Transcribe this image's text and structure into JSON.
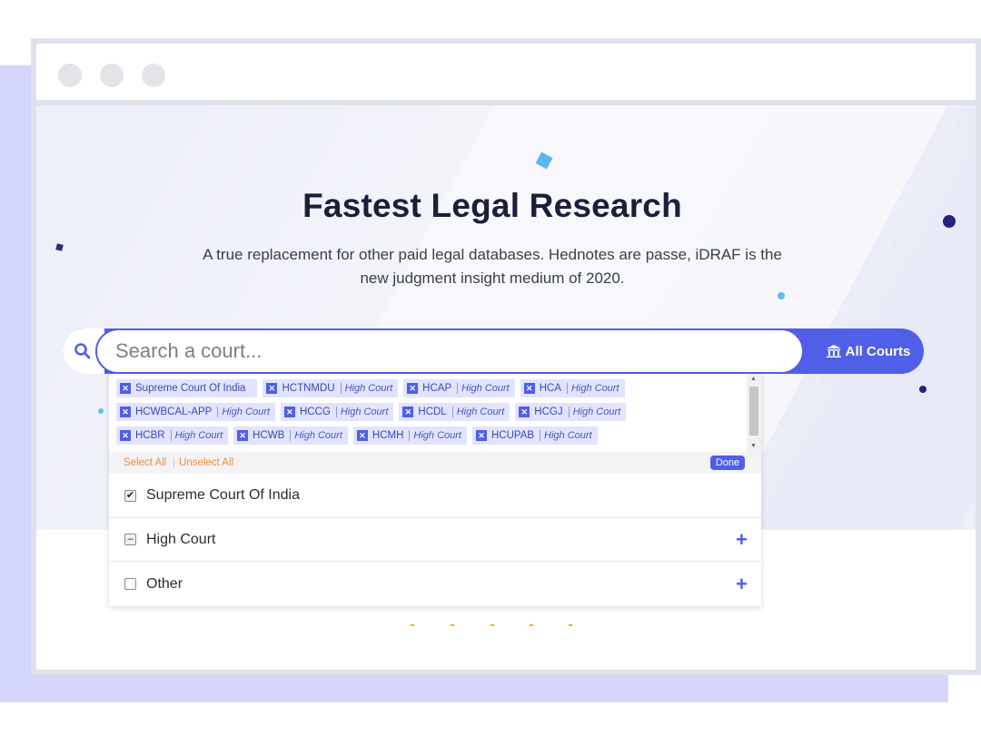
{
  "hero": {
    "title": "Fastest Legal Research",
    "subtitle_line1": "A true replacement for other paid legal databases. Hednotes are passe, iDRAF is the",
    "subtitle_line2": "new judgment insight medium of 2020."
  },
  "search": {
    "placeholder": "Search a court...",
    "courts_button_label": "All Courts",
    "courts_button_icon": "court-building-icon"
  },
  "chips": [
    [
      {
        "code": "Supreme Court Of India",
        "type": ""
      },
      {
        "code": "HCTNMDU",
        "type": "High Court"
      },
      {
        "code": "HCAP",
        "type": "High Court"
      },
      {
        "code": "HCA",
        "type": "High Court"
      }
    ],
    [
      {
        "code": "HCWBCAL-APP",
        "type": "High Court"
      },
      {
        "code": "HCCG",
        "type": "High Court"
      },
      {
        "code": "HCDL",
        "type": "High Court"
      },
      {
        "code": "HCGJ",
        "type": "High Court"
      }
    ],
    [
      {
        "code": "HCBR",
        "type": "High Court"
      },
      {
        "code": "HCWB",
        "type": "High Court"
      },
      {
        "code": "HCMH",
        "type": "High Court"
      },
      {
        "code": "HCUPAB",
        "type": "High Court"
      }
    ]
  ],
  "actions": {
    "select_all": "Select All",
    "unselect_all": "Unselect All",
    "done": "Done"
  },
  "options": [
    {
      "label": "Supreme Court Of India",
      "state": "checked",
      "expandable": false
    },
    {
      "label": "High Court",
      "state": "partial",
      "expandable": true
    },
    {
      "label": "Other",
      "state": "unchecked",
      "expandable": true
    }
  ],
  "colors": {
    "accent": "#4f5fe8",
    "title": "#1b1f3b",
    "link_orange": "#f08a3c",
    "chip_bg": "#e1e4fc"
  }
}
